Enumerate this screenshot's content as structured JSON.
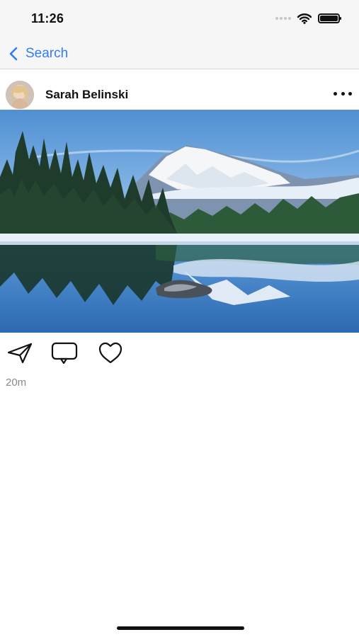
{
  "status_bar": {
    "time": "11:26",
    "icons": [
      "signal-dots-icon",
      "wifi-icon",
      "battery-icon"
    ]
  },
  "nav": {
    "back_label": "Search",
    "back_icon": "chevron-left-icon",
    "accent_color": "#2f7cf6"
  },
  "post": {
    "username": "Sarah Belinski",
    "avatar": "avatar-photo",
    "more_icon": "more-dots-icon",
    "image": "snowy-mountain-lake-reflection",
    "actions": [
      "share-icon",
      "comment-icon",
      "heart-icon"
    ],
    "timestamp": "20m"
  }
}
